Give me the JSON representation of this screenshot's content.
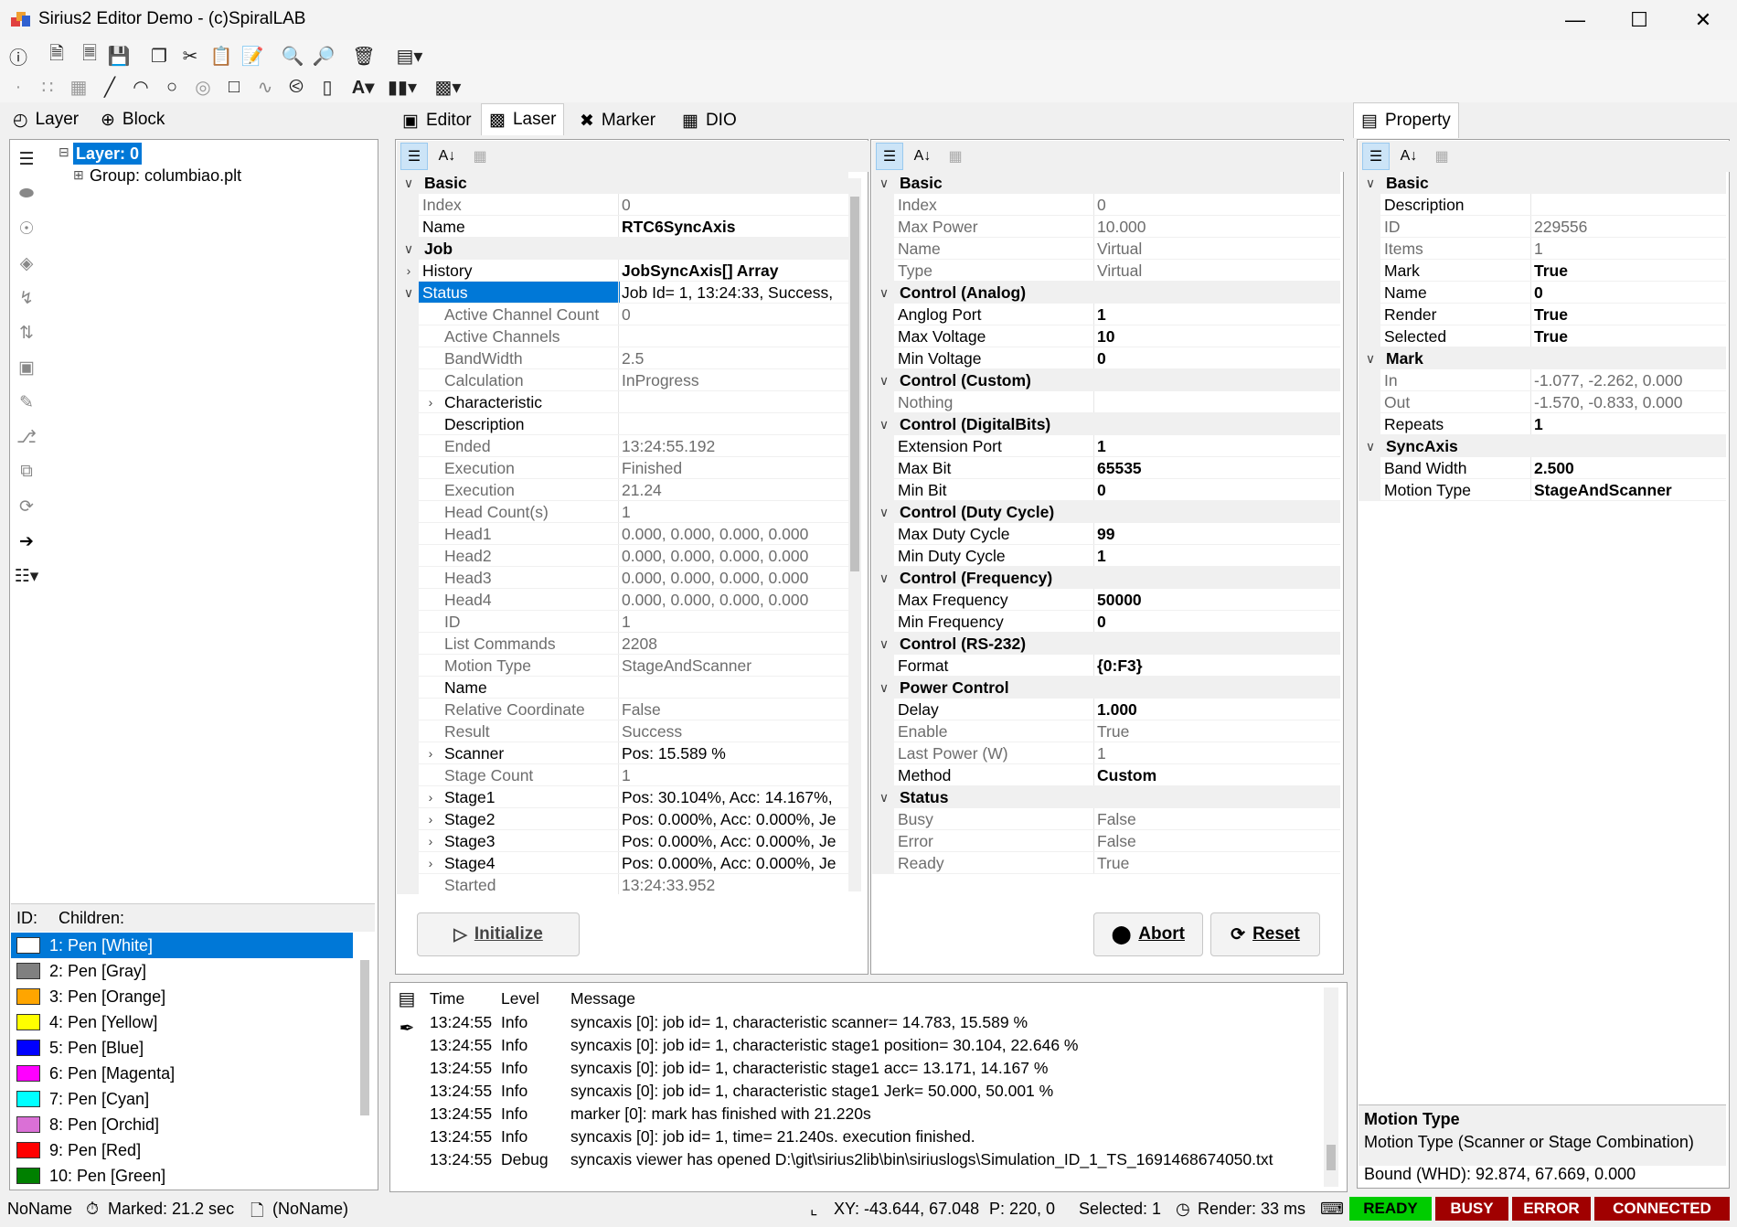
{
  "window": {
    "title": "Sirius2 Editor Demo - (c)SpiralLAB",
    "min_icon": "minimize-icon",
    "max_icon": "maximize-icon",
    "close_icon": "close-icon"
  },
  "left": {
    "tabs": [
      {
        "label": "Layer",
        "icon": "layer-tree-icon"
      },
      {
        "label": "Block",
        "icon": "block-icon"
      }
    ],
    "tree": {
      "root": "Layer: 0",
      "child": "Group: columbiao.plt"
    },
    "id_label": "ID:",
    "children_label": "Children:",
    "pens": [
      {
        "label": "1: Pen [White]",
        "color": "#ffffff"
      },
      {
        "label": "2: Pen [Gray]",
        "color": "#808080"
      },
      {
        "label": "3: Pen [Orange]",
        "color": "#ffa500"
      },
      {
        "label": "4: Pen [Yellow]",
        "color": "#ffff00"
      },
      {
        "label": "5: Pen [Blue]",
        "color": "#0000ff"
      },
      {
        "label": "6: Pen [Magenta]",
        "color": "#ff00ff"
      },
      {
        "label": "7: Pen [Cyan]",
        "color": "#00ffff"
      },
      {
        "label": "8: Pen [Orchid]",
        "color": "#da70d6"
      },
      {
        "label": "9: Pen [Red]",
        "color": "#ff0000"
      },
      {
        "label": "10: Pen [Green]",
        "color": "#008000"
      }
    ]
  },
  "center_tabs": [
    {
      "label": "Editor",
      "icon": "editor-icon"
    },
    {
      "label": "Laser",
      "icon": "laser-icon"
    },
    {
      "label": "Marker",
      "icon": "marker-icon"
    },
    {
      "label": "DIO",
      "icon": "dio-icon"
    }
  ],
  "marker_grid": {
    "rows": [
      {
        "t": "cat",
        "n": "Basic"
      },
      {
        "n": "Index",
        "v": "0",
        "s": "g"
      },
      {
        "n": "Name",
        "v": "RTC6SyncAxis",
        "s": "b"
      },
      {
        "t": "cat",
        "n": "Job"
      },
      {
        "n": "History",
        "v": "JobSyncAxis[] Array",
        "s": "b",
        "exp": true
      },
      {
        "n": "Status",
        "v": "Job Id= 1, 13:24:33, Success,",
        "sel": true,
        "open": true
      },
      {
        "n": "Active Channel Count",
        "v": "0",
        "s": "g",
        "ind": true
      },
      {
        "n": "Active Channels",
        "v": "",
        "s": "g",
        "ind": true
      },
      {
        "n": "BandWidth",
        "v": "2.5",
        "s": "g",
        "ind": true
      },
      {
        "n": "Calculation",
        "v": "InProgress",
        "s": "g",
        "ind": true
      },
      {
        "n": "Characteristic",
        "v": "",
        "s": "n",
        "ind": true,
        "exp": true
      },
      {
        "n": "Description",
        "v": "",
        "s": "n",
        "ind": true
      },
      {
        "n": "Ended",
        "v": "13:24:55.192",
        "s": "g",
        "ind": true
      },
      {
        "n": "Execution",
        "v": "Finished",
        "s": "g",
        "ind": true
      },
      {
        "n": "Execution",
        "v": "21.24",
        "s": "g",
        "ind": true
      },
      {
        "n": "Head Count(s)",
        "v": "1",
        "s": "g",
        "ind": true
      },
      {
        "n": "Head1",
        "v": "0.000, 0.000, 0.000, 0.000",
        "s": "g",
        "ind": true
      },
      {
        "n": "Head2",
        "v": "0.000, 0.000, 0.000, 0.000",
        "s": "g",
        "ind": true
      },
      {
        "n": "Head3",
        "v": "0.000, 0.000, 0.000, 0.000",
        "s": "g",
        "ind": true
      },
      {
        "n": "Head4",
        "v": "0.000, 0.000, 0.000, 0.000",
        "s": "g",
        "ind": true
      },
      {
        "n": "ID",
        "v": "1",
        "s": "g",
        "ind": true
      },
      {
        "n": "List Commands",
        "v": "2208",
        "s": "g",
        "ind": true
      },
      {
        "n": "Motion Type",
        "v": "StageAndScanner",
        "s": "g",
        "ind": true
      },
      {
        "n": "Name",
        "v": "",
        "s": "n",
        "ind": true
      },
      {
        "n": "Relative Coordinate",
        "v": "False",
        "s": "g",
        "ind": true
      },
      {
        "n": "Result",
        "v": "Success",
        "s": "g",
        "ind": true
      },
      {
        "n": "Scanner",
        "v": "Pos: 15.589 %",
        "s": "n",
        "ind": true,
        "exp": true
      },
      {
        "n": "Stage Count",
        "v": "1",
        "s": "g",
        "ind": true
      },
      {
        "n": "Stage1",
        "v": "Pos: 30.104%, Acc: 14.167%,",
        "s": "n",
        "ind": true,
        "exp": true
      },
      {
        "n": "Stage2",
        "v": "Pos: 0.000%, Acc: 0.000%, Je",
        "s": "n",
        "ind": true,
        "exp": true
      },
      {
        "n": "Stage3",
        "v": "Pos: 0.000%, Acc: 0.000%, Je",
        "s": "n",
        "ind": true,
        "exp": true
      },
      {
        "n": "Stage4",
        "v": "Pos: 0.000%, Acc: 0.000%, Je",
        "s": "n",
        "ind": true,
        "exp": true
      },
      {
        "n": "Started",
        "v": "13:24:33.952",
        "s": "g",
        "ind": true
      }
    ],
    "initialize_label": "Initialize"
  },
  "laser_grid": {
    "rows": [
      {
        "t": "cat",
        "n": "Basic"
      },
      {
        "n": "Index",
        "v": "0",
        "s": "g"
      },
      {
        "n": "Max Power",
        "v": "10.000",
        "s": "g"
      },
      {
        "n": "Name",
        "v": "Virtual",
        "s": "g"
      },
      {
        "n": "Type",
        "v": "Virtual",
        "s": "g"
      },
      {
        "t": "cat",
        "n": "Control (Analog)"
      },
      {
        "n": "Anglog Port",
        "v": "1",
        "s": "b"
      },
      {
        "n": "Max Voltage",
        "v": "10",
        "s": "b"
      },
      {
        "n": "Min Voltage",
        "v": "0",
        "s": "b"
      },
      {
        "t": "cat",
        "n": "Control (Custom)"
      },
      {
        "n": "Nothing",
        "v": "",
        "s": "g"
      },
      {
        "t": "cat",
        "n": "Control (DigitalBits)"
      },
      {
        "n": "Extension Port",
        "v": "1",
        "s": "b"
      },
      {
        "n": "Max Bit",
        "v": "65535",
        "s": "b"
      },
      {
        "n": "Min Bit",
        "v": "0",
        "s": "b"
      },
      {
        "t": "cat",
        "n": "Control (Duty Cycle)"
      },
      {
        "n": "Max Duty Cycle",
        "v": "99",
        "s": "b"
      },
      {
        "n": "Min Duty Cycle",
        "v": "1",
        "s": "b"
      },
      {
        "t": "cat",
        "n": "Control (Frequency)"
      },
      {
        "n": "Max Frequency",
        "v": "50000",
        "s": "b"
      },
      {
        "n": "Min Frequency",
        "v": "0",
        "s": "b"
      },
      {
        "t": "cat",
        "n": "Control (RS-232)"
      },
      {
        "n": "Format",
        "v": "{0:F3}",
        "s": "b"
      },
      {
        "t": "cat",
        "n": "Power Control"
      },
      {
        "n": "Delay",
        "v": "1.000",
        "s": "b"
      },
      {
        "n": "Enable",
        "v": "True",
        "s": "g"
      },
      {
        "n": "Last Power (W)",
        "v": "1",
        "s": "g"
      },
      {
        "n": "Method",
        "v": "Custom",
        "s": "b"
      },
      {
        "t": "cat",
        "n": "Status"
      },
      {
        "n": "Busy",
        "v": "False",
        "s": "g"
      },
      {
        "n": "Error",
        "v": "False",
        "s": "g"
      },
      {
        "n": "Ready",
        "v": "True",
        "s": "g"
      }
    ],
    "abort_label": "Abort",
    "reset_label": "Reset"
  },
  "property": {
    "tab_label": "Property",
    "rows": [
      {
        "t": "cat",
        "n": "Basic"
      },
      {
        "n": "Description",
        "v": "",
        "s": "n"
      },
      {
        "n": "ID",
        "v": "229556",
        "s": "g"
      },
      {
        "n": "Items",
        "v": "1",
        "s": "g"
      },
      {
        "n": "Mark",
        "v": "True",
        "s": "b"
      },
      {
        "n": "Name",
        "v": "0",
        "s": "b"
      },
      {
        "n": "Render",
        "v": "True",
        "s": "b"
      },
      {
        "n": "Selected",
        "v": "True",
        "s": "b"
      },
      {
        "t": "cat",
        "n": "Mark"
      },
      {
        "n": "In",
        "v": "-1.077, -2.262, 0.000",
        "s": "g"
      },
      {
        "n": "Out",
        "v": "-1.570, -0.833, 0.000",
        "s": "g"
      },
      {
        "n": "Repeats",
        "v": "1",
        "s": "b"
      },
      {
        "t": "cat",
        "n": "SyncAxis"
      },
      {
        "n": "Band Width",
        "v": "2.500",
        "s": "b"
      },
      {
        "n": "Motion Type",
        "v": "StageAndScanner",
        "s": "b"
      }
    ],
    "help_title": "Motion Type",
    "help_text": "Motion Type (Scanner or Stage Combination)",
    "bound": "Bound (WHD): 92.874, 67.669, 0.000"
  },
  "log": {
    "headers": {
      "time": "Time",
      "level": "Level",
      "message": "Message"
    },
    "rows": [
      {
        "time": "13:24:55",
        "level": "Info",
        "message": "syncaxis [0]: job id= 1, characteristic scanner= 14.783, 15.589 %"
      },
      {
        "time": "13:24:55",
        "level": "Info",
        "message": "syncaxis [0]: job id= 1, characteristic stage1 position= 30.104, 22.646 %"
      },
      {
        "time": "13:24:55",
        "level": "Info",
        "message": "syncaxis [0]: job id= 1, characteristic stage1 acc= 13.171, 14.167 %"
      },
      {
        "time": "13:24:55",
        "level": "Info",
        "message": "syncaxis [0]: job id= 1, characteristic stage1 Jerk= 50.000, 50.001 %"
      },
      {
        "time": "13:24:55",
        "level": "Info",
        "message": "marker [0]: mark has finished with 21.220s"
      },
      {
        "time": "13:24:55",
        "level": "Info",
        "message": "syncaxis [0]: job id= 1, time= 21.240s. execution finished."
      },
      {
        "time": "13:24:55",
        "level": "Debug",
        "message": "syncaxis viewer has opened D:\\git\\sirius2lib\\bin\\siriuslogs\\Simulation_ID_1_TS_1691468674050.txt"
      }
    ]
  },
  "status": {
    "name": "NoName",
    "marked": "Marked: 21.2 sec",
    "doc": "(NoName)",
    "xy": "XY: -43.644, 67.048",
    "p": "P: 220, 0",
    "selected": "Selected: 1",
    "render": "Render: 33 ms",
    "ready": "READY",
    "busy": "BUSY",
    "error": "ERROR",
    "connected": "CONNECTED",
    "colors": {
      "ready": "#00cc00",
      "busy": "#a00000",
      "error": "#a00000",
      "connected": "#a00000"
    }
  }
}
